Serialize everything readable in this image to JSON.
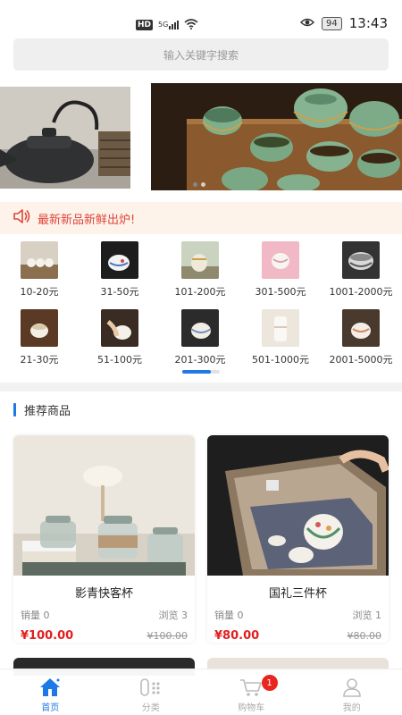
{
  "status_bar": {
    "network_hd": "HD",
    "network_gen": "5G",
    "battery": "94",
    "time": "13:43"
  },
  "search": {
    "placeholder": "输入关键字搜索"
  },
  "notice": {
    "text": "最新新品新鲜出炉!"
  },
  "price_ranges": [
    {
      "label": "10-20元"
    },
    {
      "label": "31-50元"
    },
    {
      "label": "101-200元"
    },
    {
      "label": "301-500元"
    },
    {
      "label": "1001-2000元"
    },
    {
      "label": "21-30元"
    },
    {
      "label": "51-100元"
    },
    {
      "label": "201-300元"
    },
    {
      "label": "501-1000元"
    },
    {
      "label": "2001-5000元"
    }
  ],
  "section": {
    "title": "推荐商品"
  },
  "products": [
    {
      "name": "影青快客杯",
      "sales": "销量 0",
      "views": "浏览 3",
      "price": "¥100.00",
      "original_price": "¥100.00"
    },
    {
      "name": "国礼三件杯",
      "sales": "销量 0",
      "views": "浏览 1",
      "price": "¥80.00",
      "original_price": "¥80.00"
    }
  ],
  "tabbar": {
    "items": [
      {
        "label": "首页",
        "icon": "home-icon",
        "active": true
      },
      {
        "label": "分类",
        "icon": "category-icon",
        "active": false
      },
      {
        "label": "购物车",
        "icon": "cart-icon",
        "active": false,
        "badge": "1"
      },
      {
        "label": "我的",
        "icon": "user-icon",
        "active": false
      }
    ]
  },
  "colors": {
    "accent": "#1e78e6",
    "price_red": "#e02020",
    "notice_bg": "#fdf3ea",
    "notice_text": "#e0463a"
  }
}
